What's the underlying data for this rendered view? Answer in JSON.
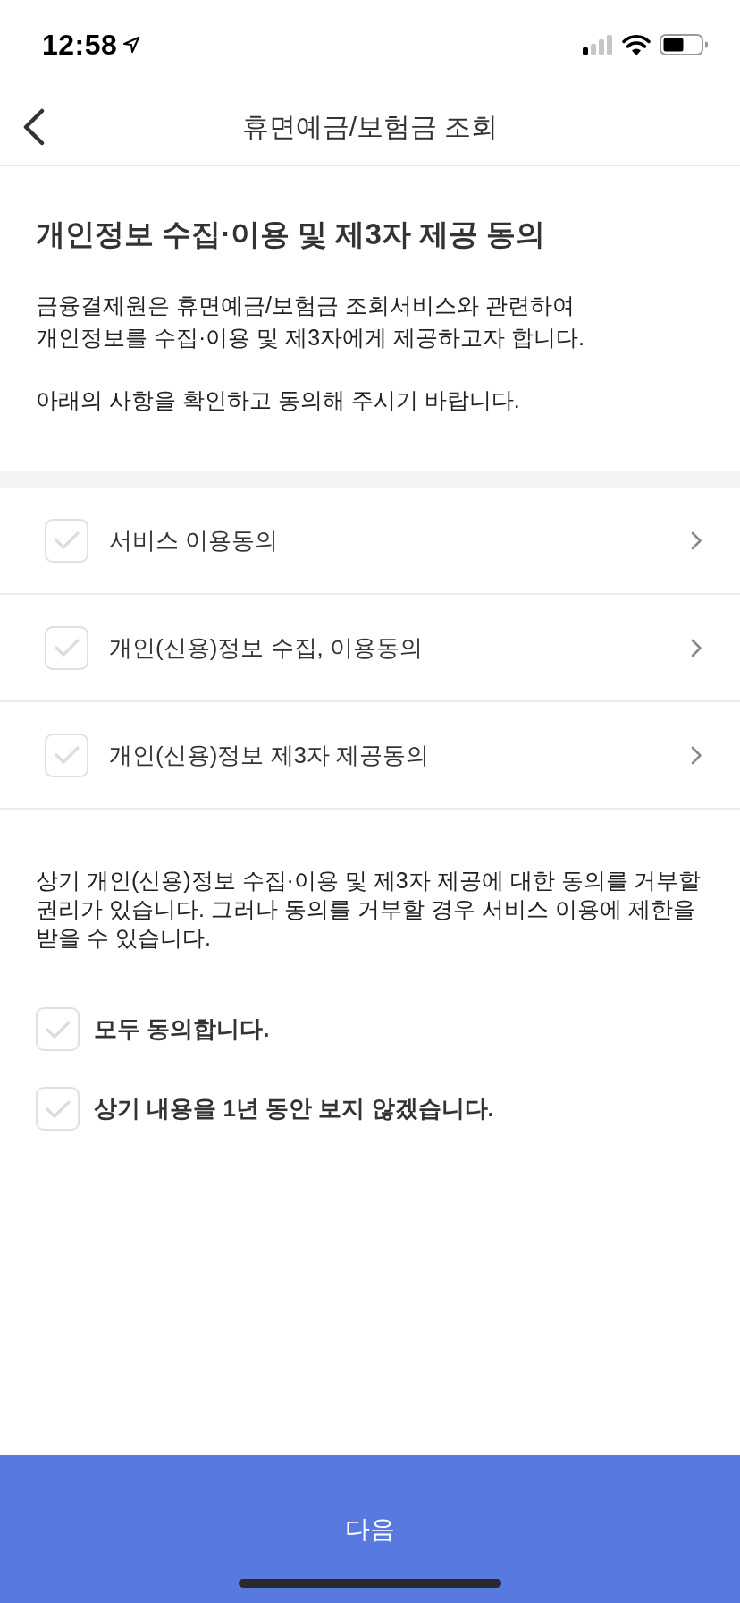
{
  "status_bar": {
    "time": "12:58"
  },
  "nav": {
    "title": "휴면예금/보험금 조회"
  },
  "intro": {
    "heading": "개인정보 수집·이용 및 제3자 제공 동의",
    "paragraphs": [
      "금융결제원은 휴면예금/보험금 조회서비스와 관련하여\n개인정보를 수집·이용 및 제3자에게 제공하고자 합니다.",
      "아래의 사항을 확인하고 동의해 주시기 바랍니다."
    ]
  },
  "consents": [
    {
      "label": "서비스 이용동의",
      "checked": false
    },
    {
      "label": "개인(신용)정보 수집, 이용동의",
      "checked": false
    },
    {
      "label": "개인(신용)정보 제3자 제공동의",
      "checked": false
    }
  ],
  "notice": "상기 개인(신용)정보 수집·이용 및 제3자 제공에 대한 동의를 거부할 권리가 있습니다. 그러나 동의를 거부할 경우 서비스 이용에 제한을 받을 수 있습니다.",
  "options": [
    {
      "label": "모두 동의합니다.",
      "checked": false
    },
    {
      "label": "상기 내용을 1년 동안 보지 않겠습니다.",
      "checked": false
    }
  ],
  "next_button": {
    "label": "다음"
  }
}
